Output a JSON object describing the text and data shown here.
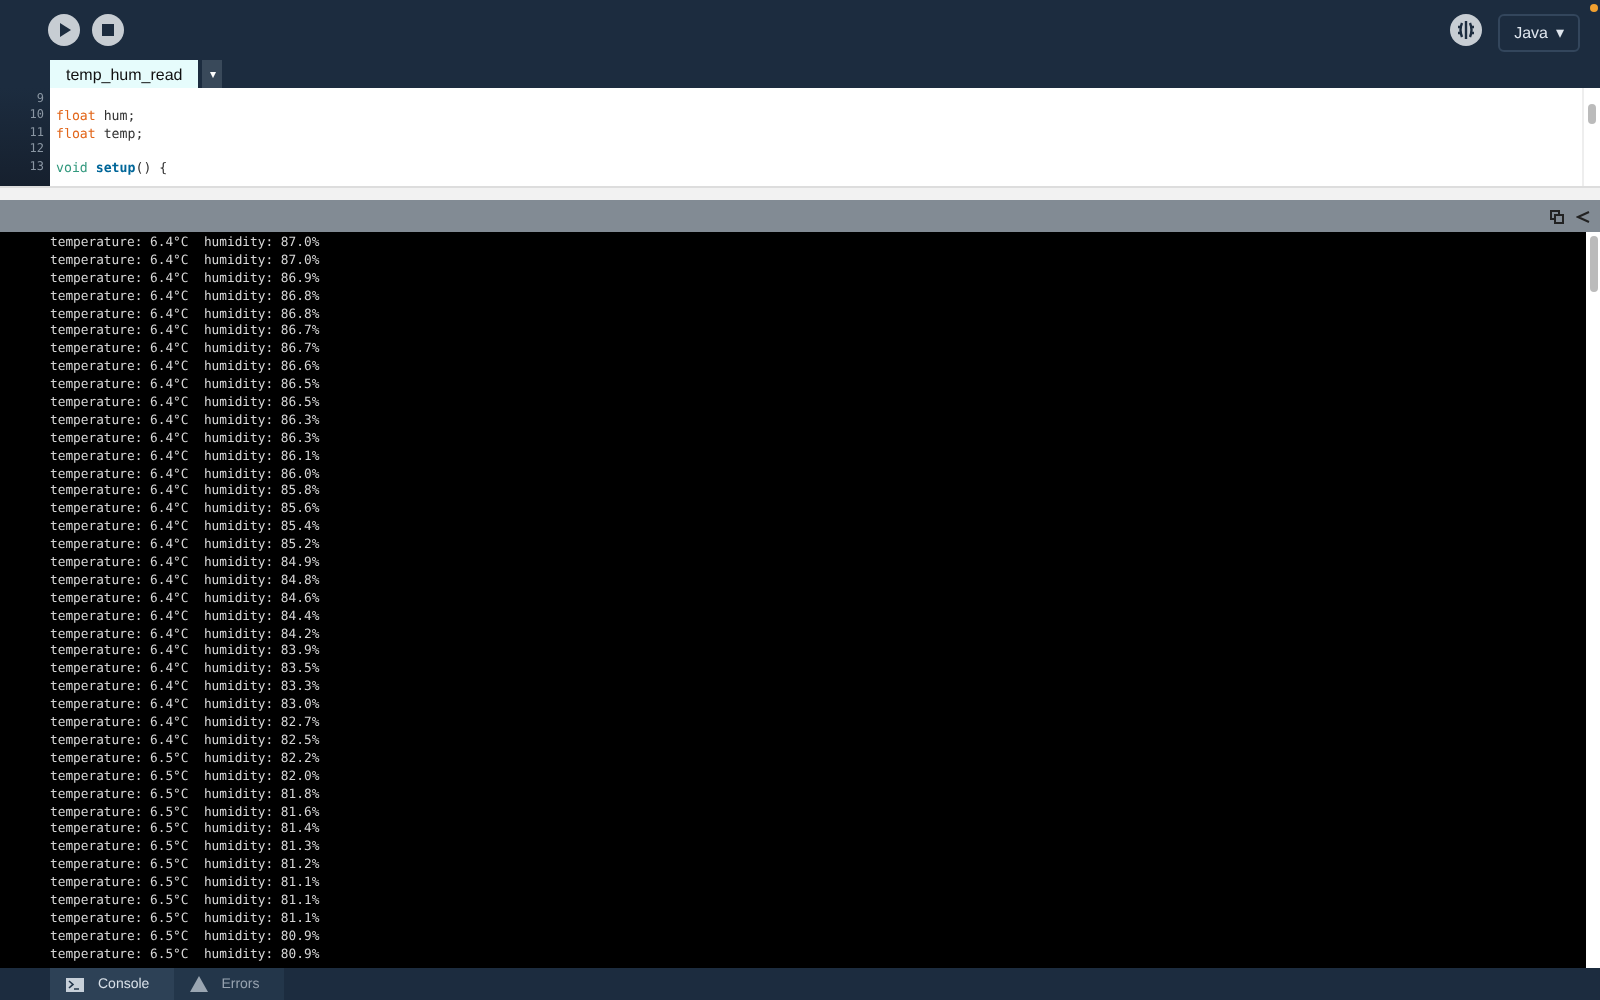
{
  "toolbar": {
    "mode": {
      "label": "Java",
      "caret": "▾"
    }
  },
  "editor": {
    "tabs": [
      {
        "label": "temp_hum_read",
        "selected": true
      }
    ],
    "tab_menu": "▾",
    "lines": [
      {
        "number": "9"
      },
      {
        "number": "10",
        "tokens": [
          {
            "text": "float",
            "kind": "datatype"
          },
          {
            "text": " hum;",
            "kind": "plain"
          }
        ]
      },
      {
        "number": "11",
        "tokens": [
          {
            "text": "float",
            "kind": "datatype"
          },
          {
            "text": " temp;",
            "kind": "plain"
          }
        ]
      },
      {
        "number": "12"
      },
      {
        "number": "13",
        "tokens": [
          {
            "text": "void",
            "kind": "keyword"
          },
          {
            "text": " setup",
            "kind": "function"
          },
          {
            "text": "() {",
            "kind": "plain"
          }
        ]
      }
    ]
  },
  "console": {
    "lines": [
      "temperature: 6.4°C  humidity: 87.0%",
      "temperature: 6.4°C  humidity: 87.0%",
      "temperature: 6.4°C  humidity: 86.9%",
      "temperature: 6.4°C  humidity: 86.8%",
      "temperature: 6.4°C  humidity: 86.8%",
      "temperature: 6.4°C  humidity: 86.7%",
      "temperature: 6.4°C  humidity: 86.7%",
      "temperature: 6.4°C  humidity: 86.6%",
      "temperature: 6.4°C  humidity: 86.5%",
      "temperature: 6.4°C  humidity: 86.5%",
      "temperature: 6.4°C  humidity: 86.3%",
      "temperature: 6.4°C  humidity: 86.3%",
      "temperature: 6.4°C  humidity: 86.1%",
      "temperature: 6.4°C  humidity: 86.0%",
      "temperature: 6.4°C  humidity: 85.8%",
      "temperature: 6.4°C  humidity: 85.6%",
      "temperature: 6.4°C  humidity: 85.4%",
      "temperature: 6.4°C  humidity: 85.2%",
      "temperature: 6.4°C  humidity: 84.9%",
      "temperature: 6.4°C  humidity: 84.8%",
      "temperature: 6.4°C  humidity: 84.6%",
      "temperature: 6.4°C  humidity: 84.4%",
      "temperature: 6.4°C  humidity: 84.2%",
      "temperature: 6.4°C  humidity: 83.9%",
      "temperature: 6.4°C  humidity: 83.5%",
      "temperature: 6.4°C  humidity: 83.3%",
      "temperature: 6.4°C  humidity: 83.0%",
      "temperature: 6.4°C  humidity: 82.7%",
      "temperature: 6.4°C  humidity: 82.5%",
      "temperature: 6.5°C  humidity: 82.2%",
      "temperature: 6.5°C  humidity: 82.0%",
      "temperature: 6.5°C  humidity: 81.8%",
      "temperature: 6.5°C  humidity: 81.6%",
      "temperature: 6.5°C  humidity: 81.4%",
      "temperature: 6.5°C  humidity: 81.3%",
      "temperature: 6.5°C  humidity: 81.2%",
      "temperature: 6.5°C  humidity: 81.1%",
      "temperature: 6.5°C  humidity: 81.1%",
      "temperature: 6.5°C  humidity: 81.1%",
      "temperature: 6.5°C  humidity: 80.9%",
      "temperature: 6.5°C  humidity: 80.9%"
    ]
  },
  "footer": {
    "tabs": [
      {
        "label": "Console",
        "kind": "console",
        "selected": true
      },
      {
        "label": "Errors",
        "kind": "errors",
        "selected": false
      }
    ]
  }
}
